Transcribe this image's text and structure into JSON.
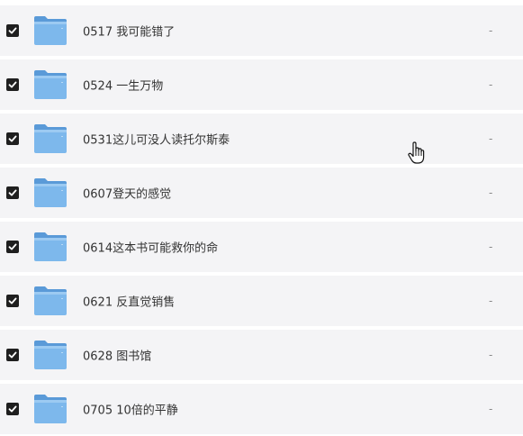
{
  "files": [
    {
      "name": "0517 我可能错了",
      "size": "-",
      "checked": true
    },
    {
      "name": "0524 一生万物",
      "size": "-",
      "checked": true
    },
    {
      "name": "0531这儿可没人读托尔斯泰",
      "size": "-",
      "checked": true
    },
    {
      "name": "0607登天的感觉",
      "size": "-",
      "checked": true
    },
    {
      "name": "0614这本书可能救你的命",
      "size": "-",
      "checked": true
    },
    {
      "name": "0621 反直觉销售",
      "size": "-",
      "checked": true
    },
    {
      "name": "0628 图书馆",
      "size": "-",
      "checked": true
    },
    {
      "name": "0705 10倍的平静",
      "size": "-",
      "checked": true
    }
  ],
  "icons": {
    "folder": "folder-icon",
    "checkbox": "checkbox-checked-icon",
    "cursor": "hand-pointer-cursor-icon"
  },
  "colors": {
    "row_background": "#f4f4f6",
    "checkbox_fill": "#1f1f1f",
    "folder_front": "#7db8ec",
    "folder_back": "#5a9ad8"
  }
}
